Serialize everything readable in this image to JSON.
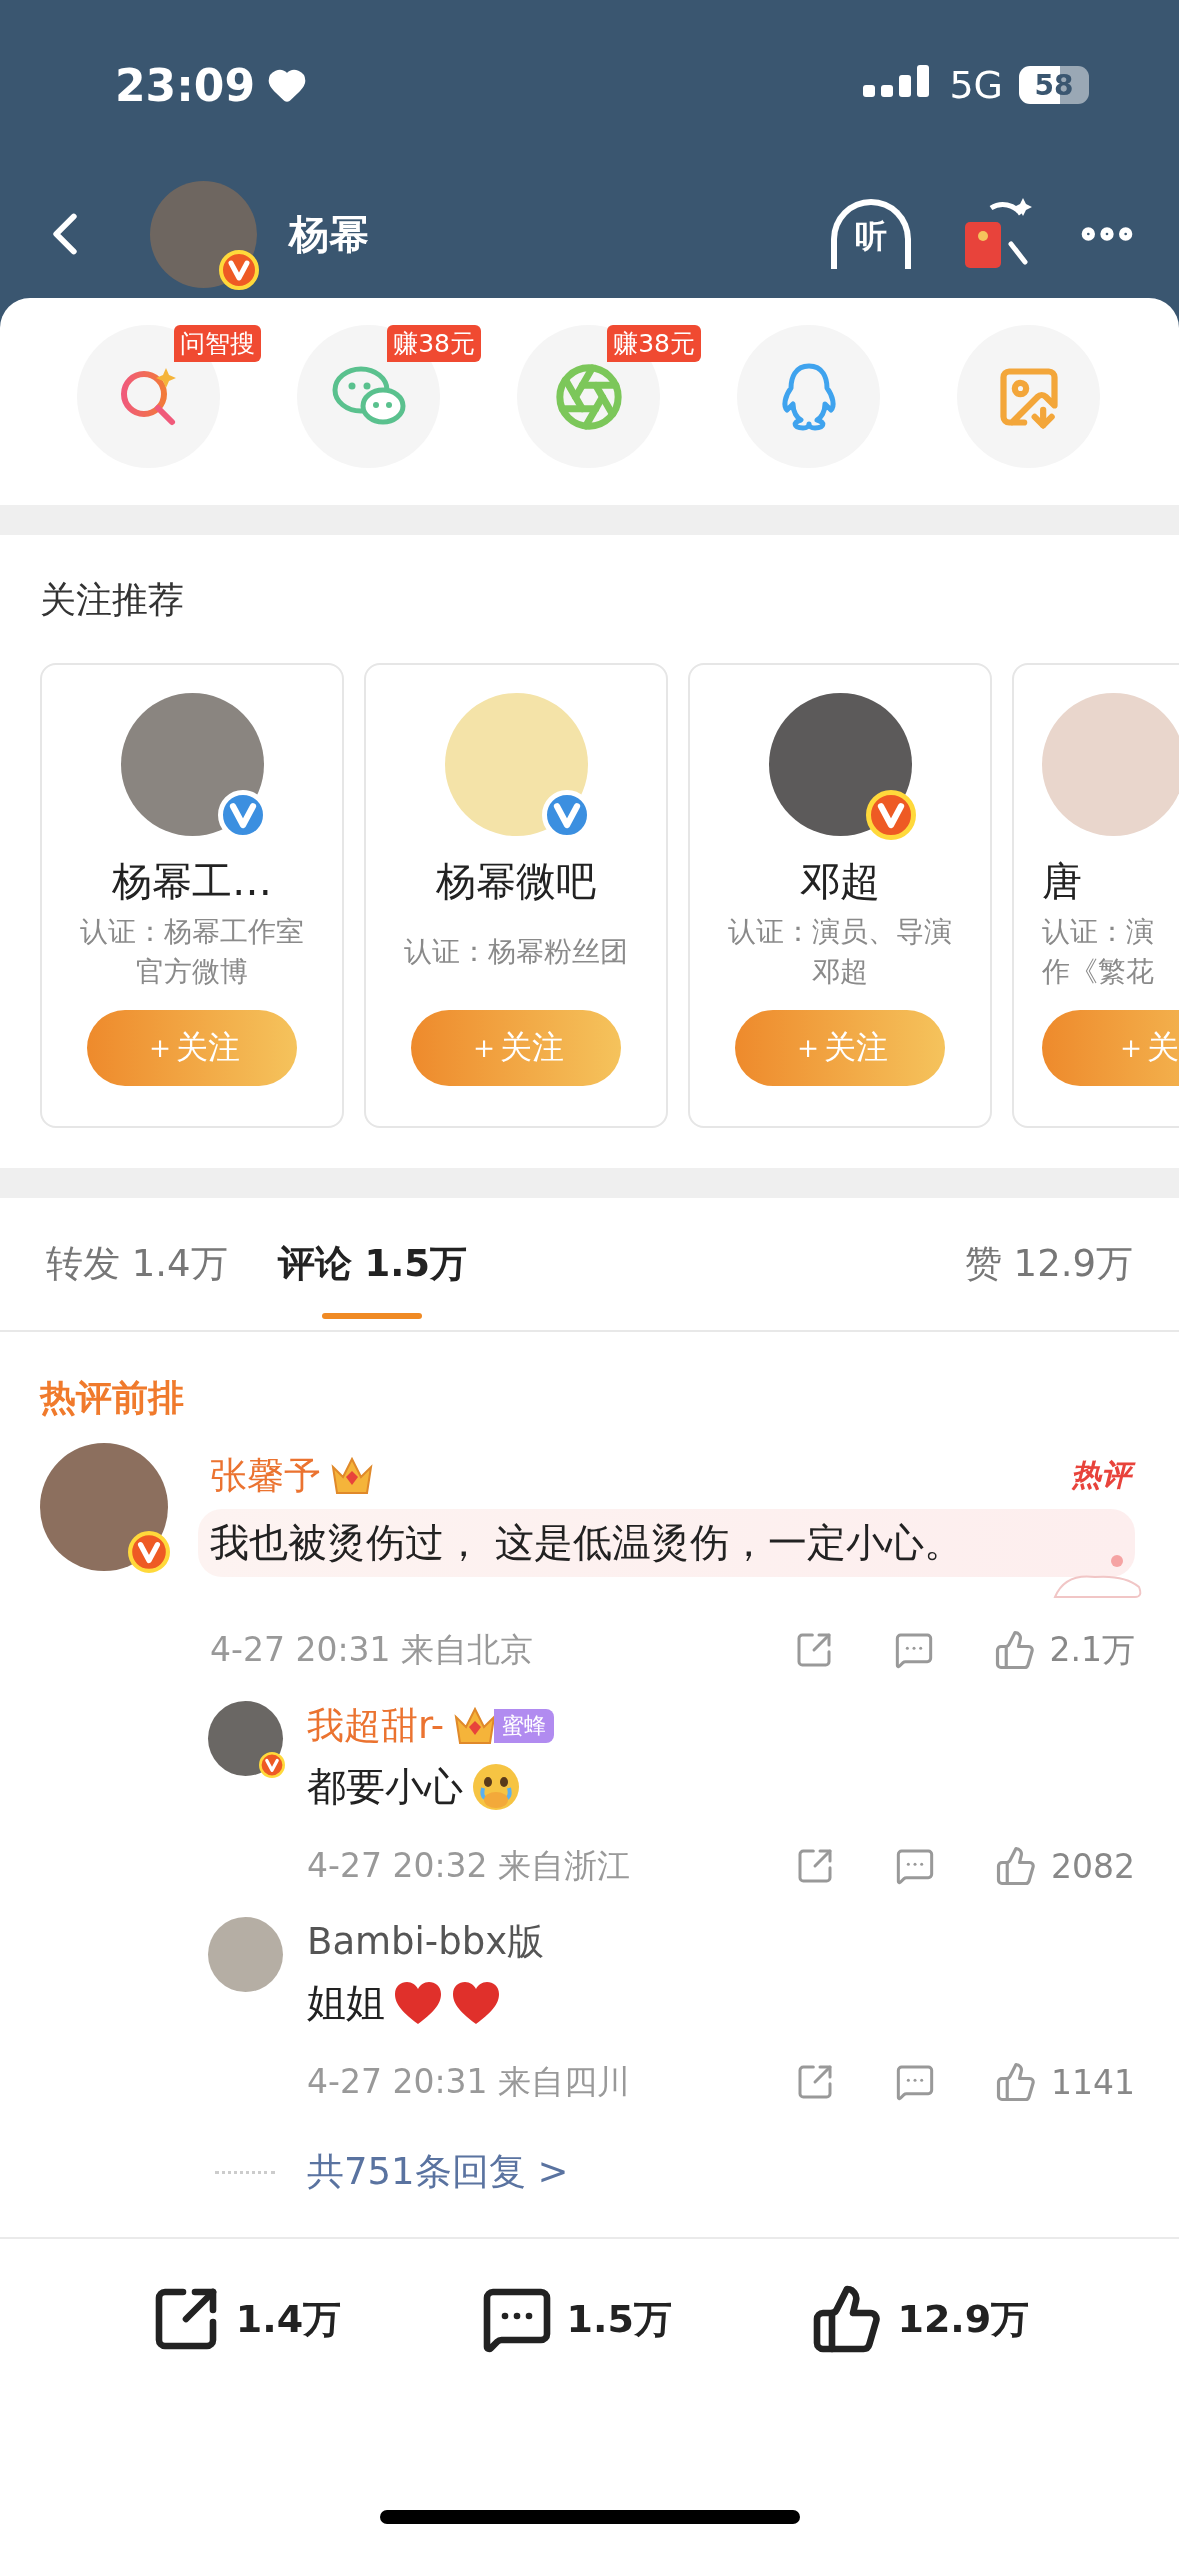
{
  "status_bar": {
    "time": "23:09",
    "network": "5G",
    "battery": "58"
  },
  "header": {
    "title": "杨幂",
    "verified": {
      "color": "#ee5a24"
    },
    "listen_label": "听"
  },
  "share_targets": [
    {
      "kind": "ai-search",
      "badge": "问智搜"
    },
    {
      "kind": "wechat",
      "badge": "赚38元"
    },
    {
      "kind": "moments",
      "badge": "赚38元"
    },
    {
      "kind": "qq"
    },
    {
      "kind": "save-image"
    }
  ],
  "recommendations": {
    "title": "关注推荐",
    "cards": [
      {
        "name": "杨幂工…",
        "verified": {
          "color": "#3b8fe0"
        },
        "description": "认证：杨幂工作室官方微博",
        "button": "＋关注"
      },
      {
        "name": "杨幂微吧",
        "verified": {
          "color": "#3b8fe0"
        },
        "description": "认证：杨幂粉丝团",
        "button": "＋关注"
      },
      {
        "name": "邓超",
        "verified": {
          "color": "#ee5a24"
        },
        "description": "认证：演员、导演邓超",
        "button": "＋关注"
      },
      {
        "name": "唐",
        "description": "认证：演作《繁花",
        "button": "＋关"
      }
    ]
  },
  "tabs": [
    {
      "label": "转发 1.4万",
      "selected": false
    },
    {
      "label": "评论 1.5万",
      "selected": true
    },
    {
      "label": "赞 12.9万",
      "selected": false
    }
  ],
  "hot_section": {
    "title": "热评前排"
  },
  "comments": [
    {
      "name": "张馨予",
      "vip": true,
      "verified": {
        "color": "#ee5a24"
      },
      "crown": true,
      "hot_tag": "热评",
      "text": "我也被烫伤过， 这是低温烫伤，一定小心。",
      "meta": "4-27 20:31 来自北京",
      "likes": "2.1万",
      "replies": [
        {
          "name": "我超甜r-",
          "vip": true,
          "verified": {
            "color": "#ee5a24"
          },
          "crown": true,
          "fan_tag": "蜜蜂",
          "text": "都要小心",
          "emoji": [
            {
              "kind": "crying-face"
            }
          ],
          "meta": "4-27 20:32 来自浙江",
          "likes": "2082"
        },
        {
          "name": "Bambi-bbx版",
          "vip": false,
          "crown": false,
          "text": "姐姐",
          "emoji": [
            {
              "kind": "heart"
            },
            {
              "kind": "heart"
            }
          ],
          "meta": "4-27 20:31 来自四川",
          "likes": "1141"
        }
      ],
      "more_replies": "共751条回复 >"
    }
  ],
  "action_bar": {
    "reposts": "1.4万",
    "comments": "1.5万",
    "likes": "12.9万"
  }
}
